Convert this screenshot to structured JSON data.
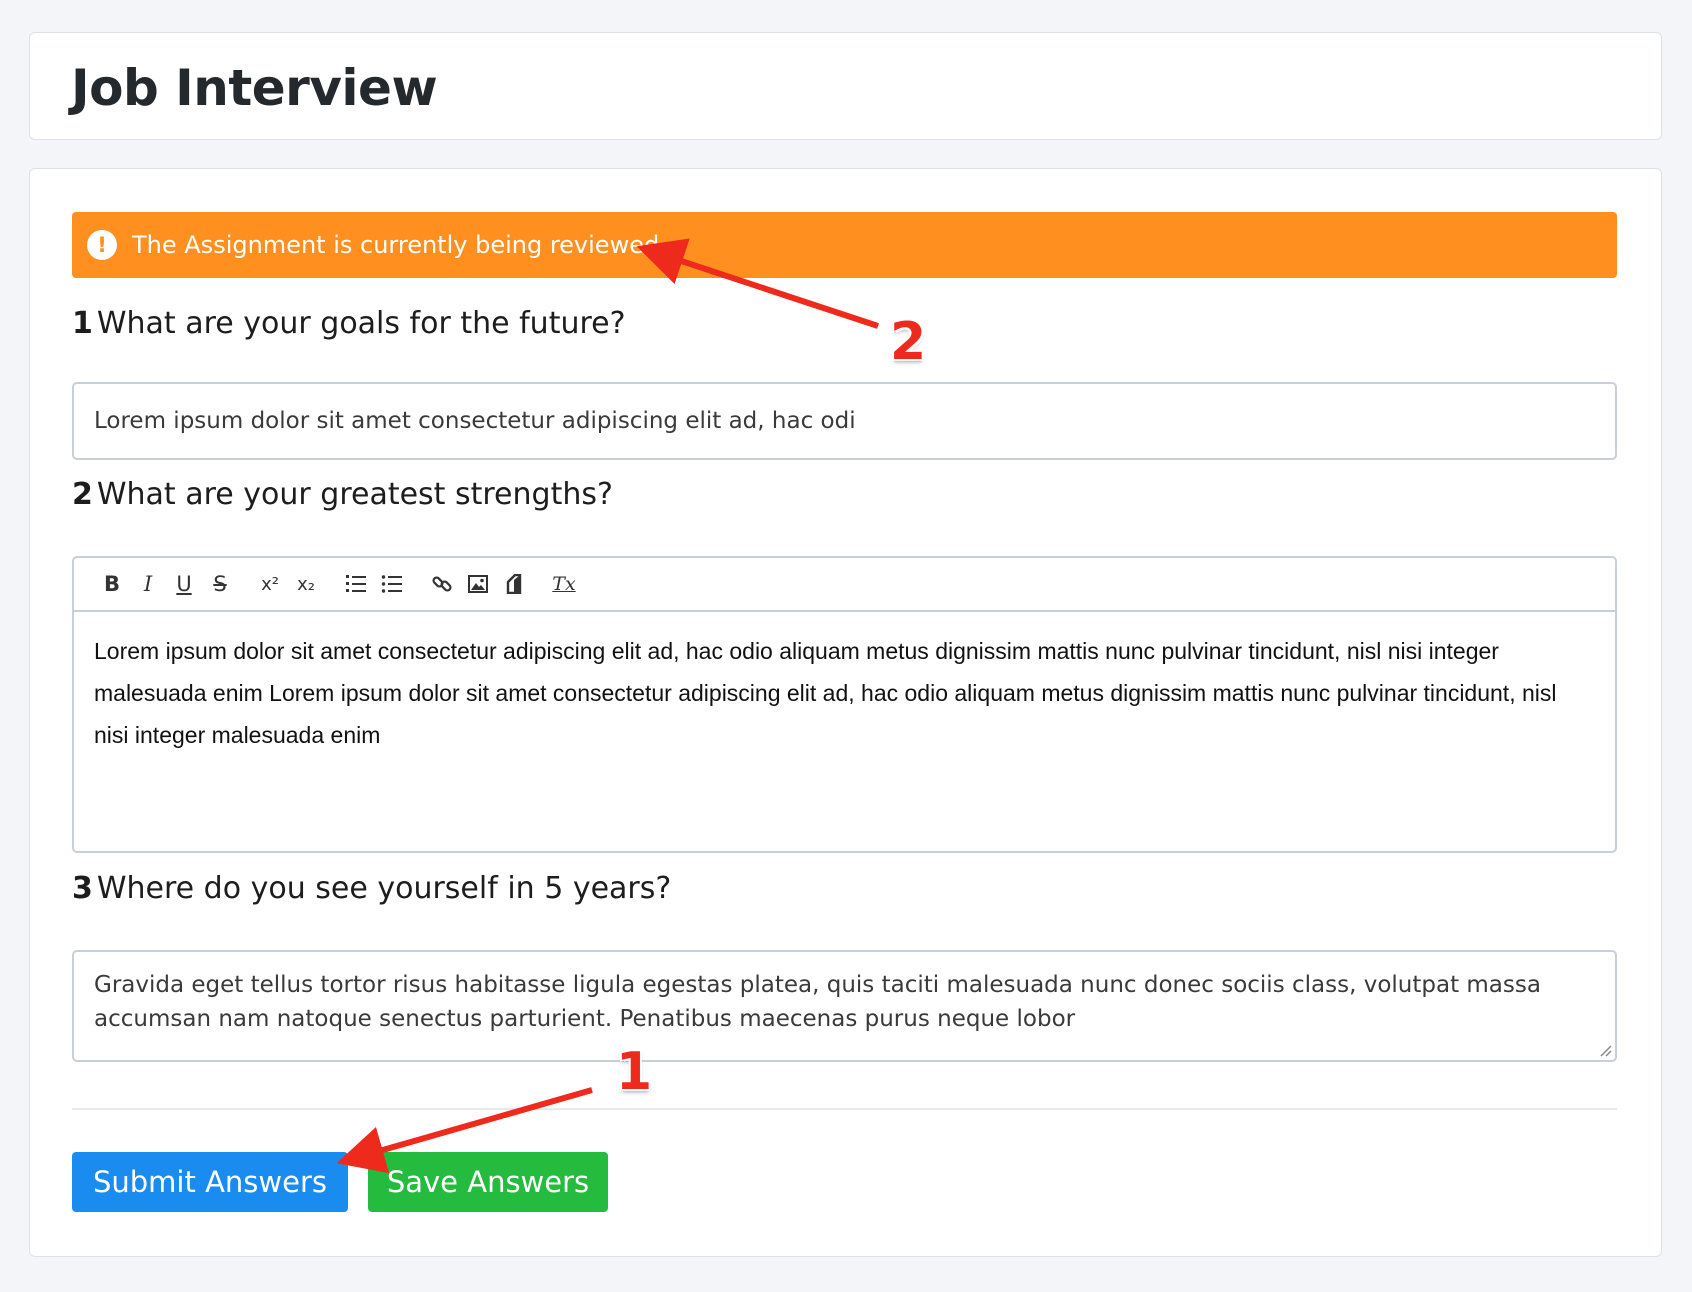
{
  "header": {
    "title": "Job Interview"
  },
  "alert": {
    "icon": "exclamation-circle-icon",
    "icon_glyph": "!",
    "message": "The Assignment is currently being reviewed."
  },
  "questions": [
    {
      "number": "1",
      "text": "What are your goals for the future?",
      "answer": "Lorem ipsum dolor sit amet consectetur adipiscing elit ad, hac odi"
    },
    {
      "number": "2",
      "text": "What are your greatest strengths?",
      "answer": "Lorem ipsum dolor sit amet consectetur adipiscing elit ad, hac odio aliquam metus dignissim mattis nunc pulvinar tincidunt, nisl nisi integer malesuada enim Lorem ipsum dolor sit amet consectetur adipiscing elit ad, hac odio aliquam metus dignissim mattis nunc pulvinar tincidunt, nisl nisi integer malesuada enim"
    },
    {
      "number": "3",
      "text": "Where do you see yourself in 5 years?",
      "answer": "Gravida eget tellus tortor risus habitasse ligula egestas platea, quis taciti malesuada nunc donec sociis class, volutpat massa accumsan nam natoque senectus parturient. Penatibus maecenas purus neque lobor"
    }
  ],
  "editor_toolbar": [
    {
      "name": "bold-icon",
      "glyph": "B"
    },
    {
      "name": "italic-icon",
      "glyph": "I"
    },
    {
      "name": "underline-icon",
      "glyph": "U"
    },
    {
      "name": "strikethrough-icon",
      "glyph": "S"
    },
    {
      "name": "superscript-icon",
      "glyph": "x²"
    },
    {
      "name": "subscript-icon",
      "glyph": "x₂"
    },
    {
      "name": "ordered-list-icon",
      "glyph": ""
    },
    {
      "name": "bullet-list-icon",
      "glyph": ""
    },
    {
      "name": "link-icon",
      "glyph": ""
    },
    {
      "name": "image-icon",
      "glyph": ""
    },
    {
      "name": "formula-icon",
      "glyph": ""
    },
    {
      "name": "clear-format-icon",
      "glyph": "Tx"
    }
  ],
  "buttons": {
    "submit": "Submit Answers",
    "save": "Save Answers"
  },
  "annotations": [
    {
      "label": "1"
    },
    {
      "label": "2"
    }
  ],
  "colors": {
    "alert": "#ff9020",
    "submit": "#1a8cf0",
    "save": "#24bb3f",
    "annotation": "#ee2a1c"
  }
}
